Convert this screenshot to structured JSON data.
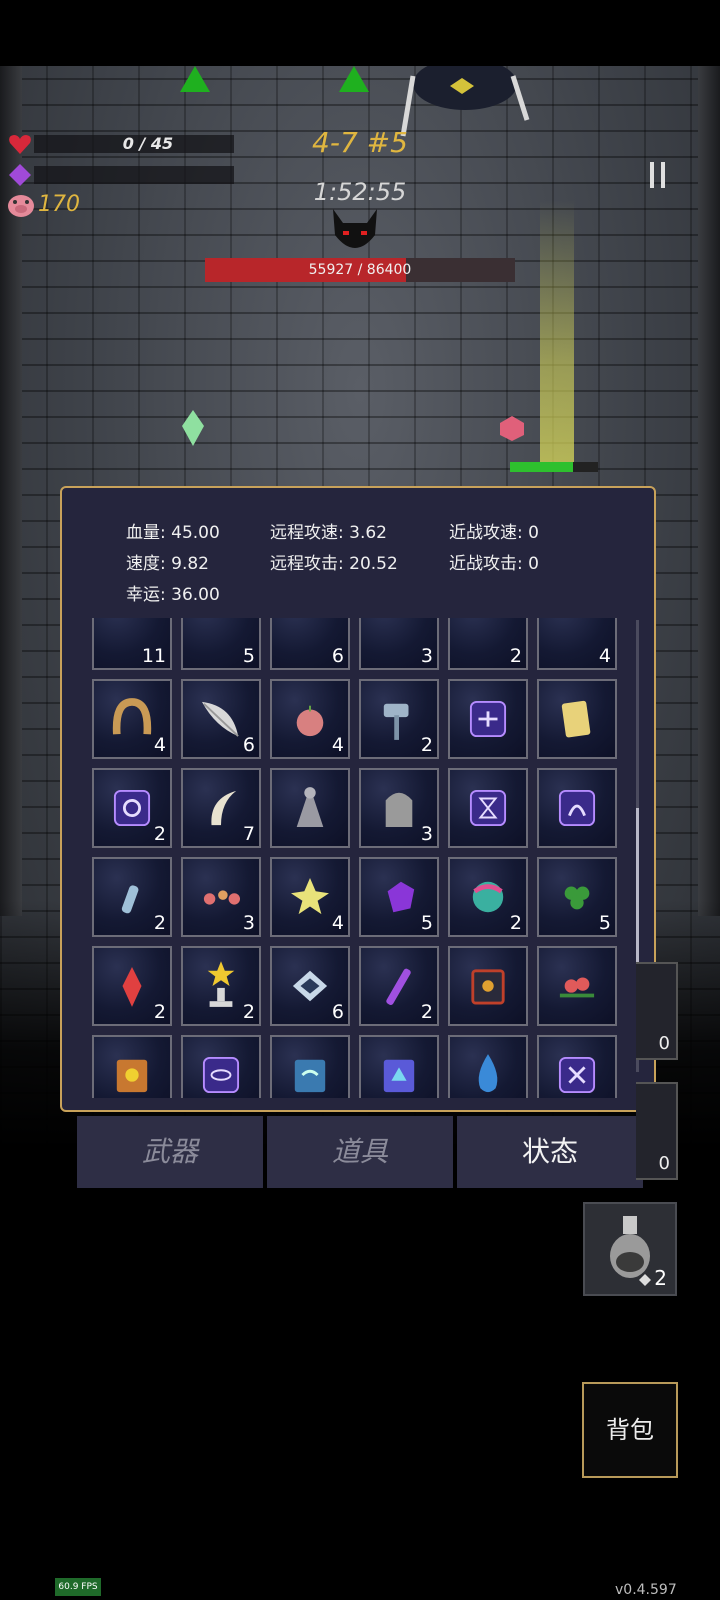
{
  "hud": {
    "hp": "0 / 45",
    "gold": "170",
    "stage": "4-7 #5",
    "timer": "1:52:55"
  },
  "boss": {
    "hp_text": "55927 / 86400",
    "hp_fraction": 0.647
  },
  "stats": {
    "hp": "血量:  45.00",
    "speed": "速度:  9.82",
    "luck": "幸运:  36.00",
    "ranged_speed": "远程攻速:  3.62",
    "ranged_attack": "远程攻击:  20.52",
    "melee_speed": "近战攻速:  0",
    "melee_attack": "近战攻击:  0"
  },
  "top_partial_counts": [
    "11",
    "5",
    "6",
    "3",
    "2",
    "4"
  ],
  "items": [
    {
      "icon": "horseshoe-icon",
      "count": "4"
    },
    {
      "icon": "feather-icon",
      "count": "6"
    },
    {
      "icon": "apple-icon",
      "count": "4"
    },
    {
      "icon": "mallet-icon",
      "count": "2"
    },
    {
      "icon": "rune-arrows-icon",
      "count": ""
    },
    {
      "icon": "golden-ticket-icon",
      "count": ""
    },
    {
      "icon": "rune-spiral-icon",
      "count": "2"
    },
    {
      "icon": "horn-icon",
      "count": "7"
    },
    {
      "icon": "cloak-icon",
      "count": ""
    },
    {
      "icon": "gravestone-icon",
      "count": "3"
    },
    {
      "icon": "rune-hourglass-icon",
      "count": ""
    },
    {
      "icon": "rune-curve-icon",
      "count": ""
    },
    {
      "icon": "bottle-icon",
      "count": "2"
    },
    {
      "icon": "flower-garland-icon",
      "count": "3"
    },
    {
      "icon": "star-crystal-icon",
      "count": "4"
    },
    {
      "icon": "purple-gem-icon",
      "count": "5"
    },
    {
      "icon": "rainbow-orb-icon",
      "count": "2"
    },
    {
      "icon": "clover-icon",
      "count": "5"
    },
    {
      "icon": "red-crystal-icon",
      "count": "2"
    },
    {
      "icon": "star-trophy-icon",
      "count": "2"
    },
    {
      "icon": "diamond-tile-icon",
      "count": "6"
    },
    {
      "icon": "purple-wand-icon",
      "count": "2"
    },
    {
      "icon": "skull-book-icon",
      "count": ""
    },
    {
      "icon": "rose-bouquet-icon",
      "count": ""
    },
    {
      "icon": "sun-book-icon",
      "count": ""
    },
    {
      "icon": "rune-eye-icon",
      "count": ""
    },
    {
      "icon": "wind-book-icon",
      "count": ""
    },
    {
      "icon": "triangle-book-icon",
      "count": ""
    },
    {
      "icon": "water-drop-icon",
      "count": ""
    },
    {
      "icon": "rune-cross-icon",
      "count": ""
    }
  ],
  "tabs": [
    "武器",
    "道具",
    "状态"
  ],
  "active_tab": "状态",
  "side_slots": [
    "0",
    "0"
  ],
  "potion_count": "2",
  "bag_label": "背包",
  "fps": "60.9 FPS",
  "version": "v0.4.597",
  "colors": {
    "panel_bg": "#25253d",
    "panel_border": "#c8a25a",
    "gold_text": "#e0b640",
    "boss_bar": "#b8262a"
  }
}
